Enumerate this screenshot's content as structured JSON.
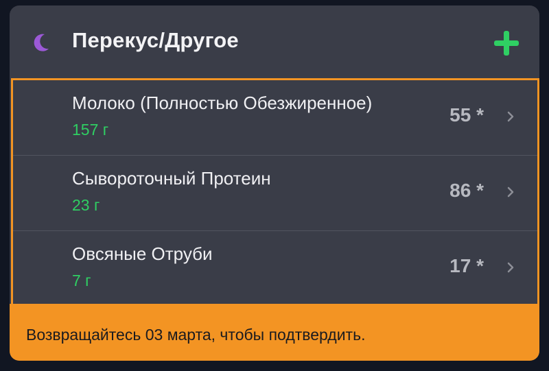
{
  "header": {
    "icon": "moon-icon",
    "title": "Перекус/Другое",
    "add_icon": "plus-icon",
    "accent_color": "#2fcf63",
    "moon_color": "#9b59d6"
  },
  "items": [
    {
      "name": "Молоко (Полностью Обезжиренное)",
      "amount": "157 г",
      "value": "55 *"
    },
    {
      "name": "Сывороточный Протеин",
      "amount": "23 г",
      "value": "86 *"
    },
    {
      "name": "Овсяные Отруби",
      "amount": "7 г",
      "value": "17 *"
    }
  ],
  "footer": {
    "text": "Возвращайтесь 03 марта, чтобы подтвердить.",
    "background_color": "#f39423"
  }
}
